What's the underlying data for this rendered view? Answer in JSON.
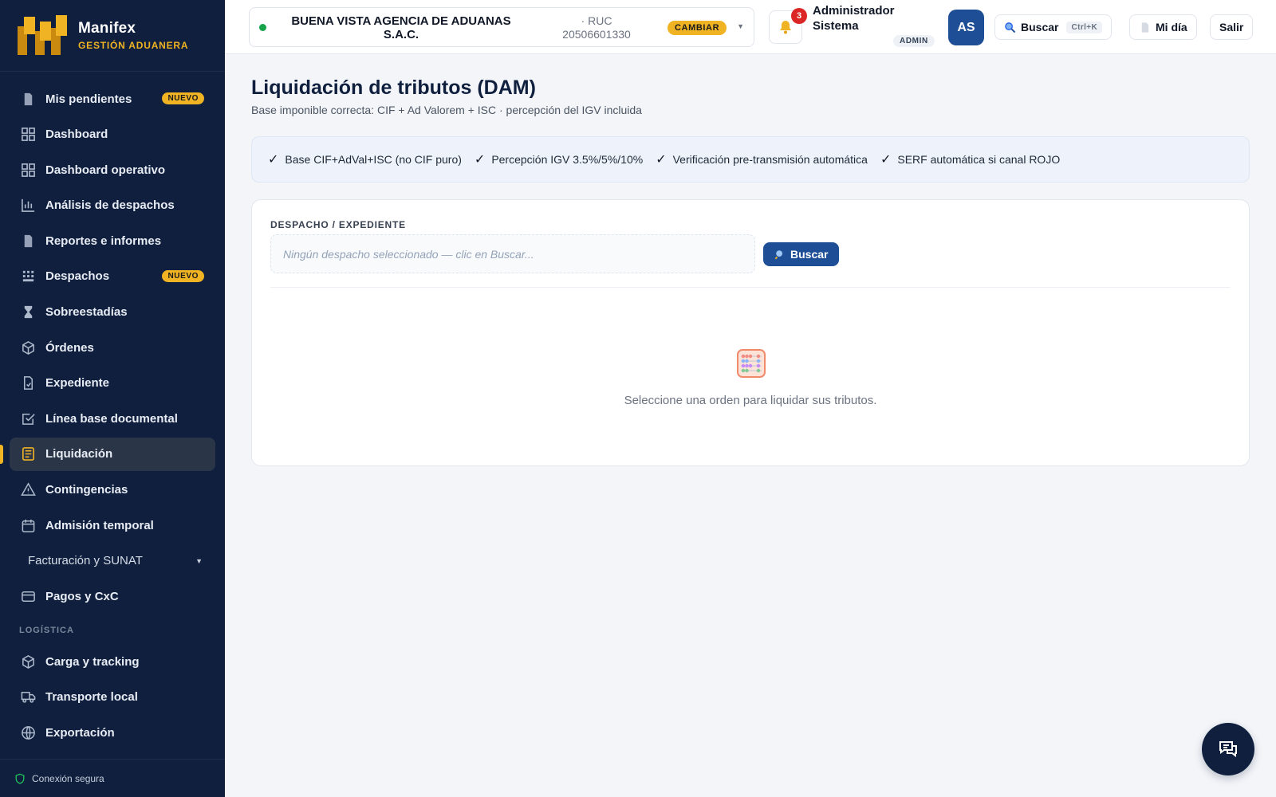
{
  "brand": {
    "name": "Manifex",
    "subtitle": "GESTIÓN ADUANERA"
  },
  "sidebar": {
    "items": [
      {
        "label": "Mis pendientes",
        "icon": "document-icon",
        "badge": "NUEVO"
      },
      {
        "label": "Dashboard",
        "icon": "grid-icon"
      },
      {
        "label": "Dashboard operativo",
        "icon": "grid-icon"
      },
      {
        "label": "Análisis de despachos",
        "icon": "bar-chart-icon"
      },
      {
        "label": "Reportes e informes",
        "icon": "document-icon"
      },
      {
        "label": "Despachos",
        "icon": "container-icon",
        "badge": "NUEVO"
      },
      {
        "label": "Sobreestadías",
        "icon": "hourglass-icon"
      },
      {
        "label": "Órdenes",
        "icon": "box-icon"
      },
      {
        "label": "Expediente",
        "icon": "file-icon"
      },
      {
        "label": "Línea base documental",
        "icon": "checkbox-icon"
      },
      {
        "label": "Liquidación",
        "icon": "receipt-icon",
        "active": true
      },
      {
        "label": "Contingencias",
        "icon": "warning-icon"
      },
      {
        "label": "Admisión temporal",
        "icon": "calendar-icon"
      }
    ],
    "group": {
      "label": "Facturación y SUNAT"
    },
    "payments": {
      "label": "Pagos y CxC",
      "icon": "card-icon"
    },
    "section_logistics": "LOGÍSTICA",
    "logistics": [
      {
        "label": "Carga y tracking",
        "icon": "box-icon"
      },
      {
        "label": "Transporte local",
        "icon": "truck-icon"
      },
      {
        "label": "Exportación",
        "icon": "globe-icon"
      }
    ],
    "footer": "Conexión segura"
  },
  "topbar": {
    "agency_name": "BUENA VISTA AGENCIA DE ADUANAS S.A.C.",
    "ruc_label": "· RUC",
    "ruc": "20506601330",
    "change_label": "CAMBIAR",
    "notifications": "3",
    "user_name": "Administrador Sistema",
    "role": "ADMIN",
    "avatar": "AS",
    "search_label": "Buscar",
    "search_shortcut": "Ctrl+K",
    "my_day_label": "Mi día",
    "logout_label": "Salir"
  },
  "main": {
    "title": "Liquidación de tributos (DAM)",
    "subtitle": "Base imponible correcta: CIF + Ad Valorem + ISC · percepción del IGV incluida",
    "checks": [
      "Base CIF+AdVal+ISC (no CIF puro)",
      "Percepción IGV 3.5%/5%/10%",
      "Verificación pre-transmisión automática",
      "SERF automática si canal ROJO"
    ],
    "field_label": "DESPACHO / EXPEDIENTE",
    "field_placeholder": "Ningún despacho seleccionado — clic en Buscar...",
    "search_button": "Buscar",
    "empty_message": "Seleccione una orden para liquidar sus tributos."
  },
  "colors": {
    "sidebar": "#0f1f3d",
    "accent": "#f0b323",
    "primary": "#1e4f96",
    "danger": "#dc2626"
  }
}
